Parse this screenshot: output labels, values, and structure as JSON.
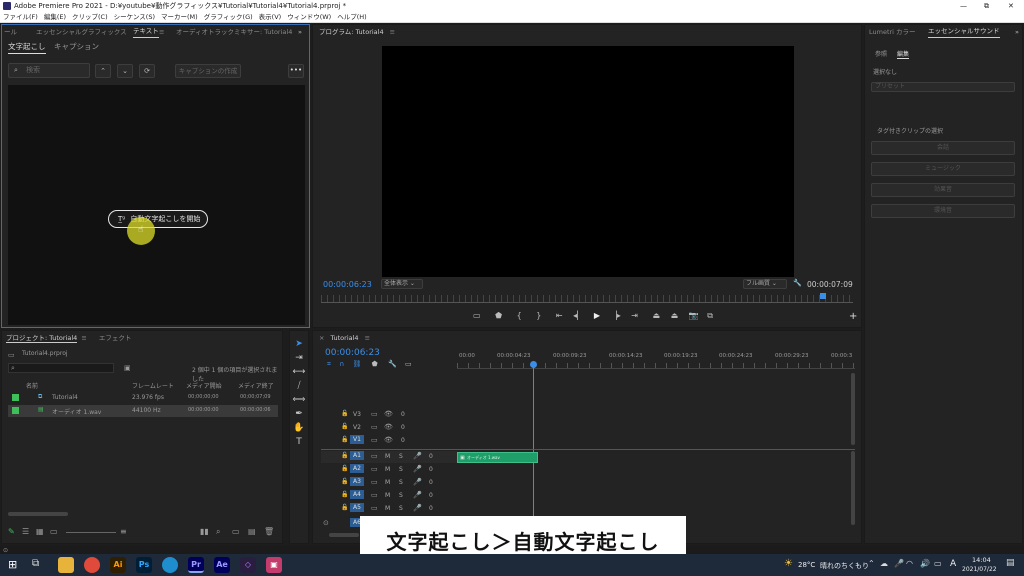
{
  "window": {
    "title": "Adobe Premiere Pro 2021 - D:¥youtube¥動作グラフィックス¥Tutorial¥Tutorial4¥Tutorial4.prproj *",
    "controls": [
      "—",
      "⧉",
      "✕"
    ]
  },
  "menu": [
    "ファイル(F)",
    "編集(E)",
    "クリップ(C)",
    "シーケンス(S)",
    "マーカー(M)",
    "グラフィック(G)",
    "表示(V)",
    "ウィンドウ(W)",
    "ヘルプ(H)"
  ],
  "top_tabs": {
    "left_cut": "ール",
    "essential_graphics": "エッセンシャルグラフィックス",
    "text": "テキスト",
    "audio_mixer": "オーディオトラックミキサー: Tutorial4"
  },
  "text_panel": {
    "tab_transcribe": "文字起こし",
    "tab_captions": "キャプション",
    "search_placeholder": "検索",
    "create_captions": "キャプションの作成",
    "auto_transcribe": "自動文字起こしを開始"
  },
  "program": {
    "title": "プログラム: Tutorial4",
    "timecode": "00:00:06:23",
    "fit": "全体表示",
    "quality": "フル画質",
    "duration": "00:00:07:09"
  },
  "right_panel": {
    "tab_lumetri": "Lumetri カラー",
    "tab_essential_sound": "エッセンシャルサウンド",
    "sub_browse": "参照",
    "sub_edit": "編集",
    "no_selection": "選択なし",
    "preset": "プリセット",
    "tag_label": "タグ付きクリップの選択",
    "btn_dialogue": "会話",
    "btn_music": "ミュージック",
    "btn_sfx": "効果音",
    "btn_ambience": "環境音"
  },
  "project": {
    "title": "プロジェクト: Tutorial4",
    "effects": "エフェクト",
    "file": "Tutorial4.prproj",
    "selected": "2 個中 1 個の項目が選択されました",
    "columns": [
      "名前",
      "フレームレート",
      "メディア開始",
      "メディア終了"
    ],
    "rows": [
      {
        "name": "Tutorial4",
        "fps": "23.976 fps",
        "start": "00;00;00;00",
        "end": "00;00;07;09",
        "color": "#3fbf5a"
      },
      {
        "name": "オーディオ 1.wav",
        "fps": "44100 Hz",
        "start": "00:00:00:00",
        "end": "00:00:00:06",
        "color": "#3fbf5a"
      }
    ]
  },
  "timeline": {
    "title": "Tutorial4",
    "timecode": "00:00:06:23",
    "ruler": [
      "00:00",
      "00:00:04:23",
      "00:00:09:23",
      "00:00:14:23",
      "00:00:19:23",
      "00:00:24:23",
      "00:00:29:23",
      "00:00:3"
    ],
    "video_tracks": [
      "V3",
      "V2",
      "V1"
    ],
    "audio_tracks": [
      "A1",
      "A2",
      "A3",
      "A4",
      "A5"
    ],
    "source_label": "A1",
    "clip_label": "オーディオ 1.wav",
    "zero": "0",
    "m": "M",
    "s": "S",
    "master": "A6"
  },
  "caption": "文字起こし＞自動文字起こし",
  "taskbar": {
    "weather": "28°C",
    "weather_text": "晴れのちくもり",
    "ime": "A",
    "time": "14:04",
    "date": "2021/07/22"
  }
}
